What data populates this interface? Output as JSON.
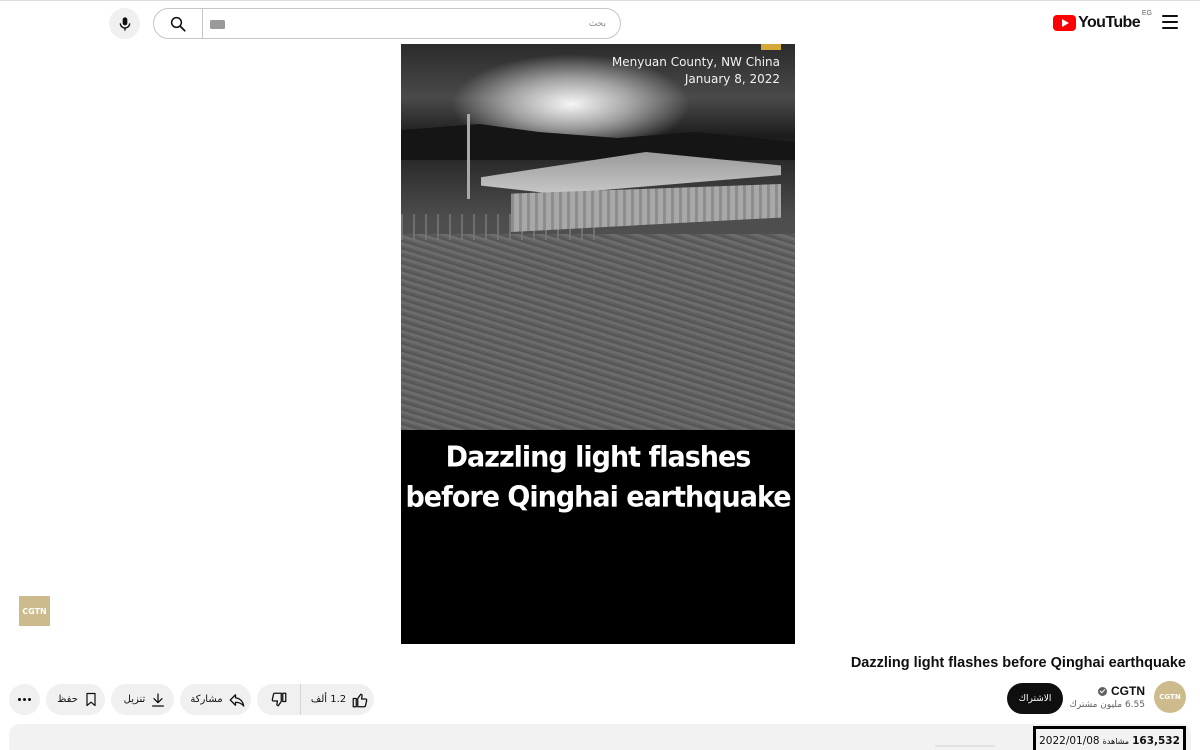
{
  "header": {
    "brand": "YouTube",
    "country_code": "EG",
    "search_placeholder": "بحث"
  },
  "video": {
    "overlay_location": "Menyuan County, NW China",
    "overlay_date": "January 8, 2022",
    "caption_line1": "Dazzling light flashes",
    "caption_line2": "before Qinghai earthquake",
    "watermark_logo": "CGTN"
  },
  "details": {
    "title": "Dazzling light flashes before Qinghai earthquake",
    "channel": {
      "name": "CGTN",
      "avatar_text": "CGTN",
      "subscribers": "6.55 مليون مشترك",
      "verified": true
    },
    "subscribe_label": "الاشتراك",
    "actions": {
      "likes": "1.2 ألف",
      "share_label": "مشاركة",
      "download_label": "تنزيل",
      "save_label": "حفظ"
    },
    "description": {
      "views": "163,532",
      "views_label": "مشاهدة",
      "published": "2022/01/08"
    }
  },
  "colors": {
    "brand_red": "#ff0000",
    "channel_gold": "#cdbb8d",
    "subscribe_bg": "#0f0f0f",
    "pill_bg": "#f0f0f0"
  }
}
